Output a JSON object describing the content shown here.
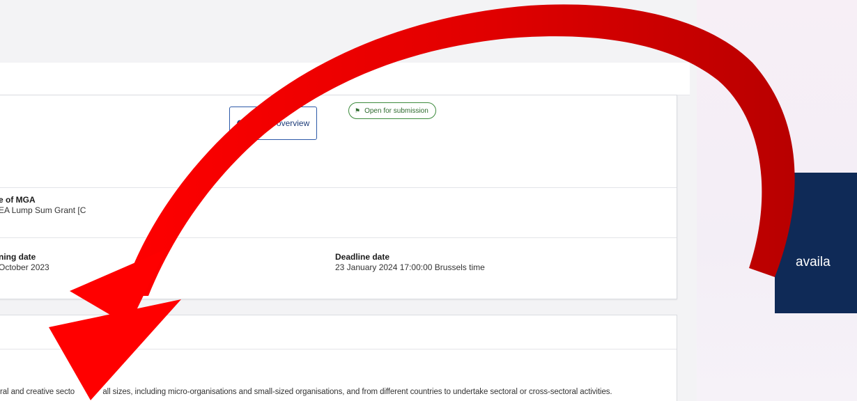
{
  "budget_button": {
    "icon": "euro-icon",
    "label": "Budget overview",
    "symbol": "€"
  },
  "fields": {
    "mga_label": "e of MGA",
    "mga_value": "EA Lump Sum Grant [C",
    "status_label": "Open for submission",
    "opening_label": "ning date",
    "opening_value": "October 2023",
    "deadline_label": "Deadline date",
    "deadline_value": "23 January 2024 17:00:00 Brussels time"
  },
  "description": {
    "text_left": "ral and creative secto",
    "text_right": "all sizes, including micro-organisations and small-sized organisations, and from different countries to undertake sectoral or cross-sectoral activities."
  },
  "side_panel": {
    "text": "availa"
  },
  "colors": {
    "status_green": "#3c8a3c",
    "navy": "#0f2a57",
    "arrow_red": "#e00000",
    "arrow_dark": "#b30000",
    "button_blue": "#2d5aa8"
  }
}
